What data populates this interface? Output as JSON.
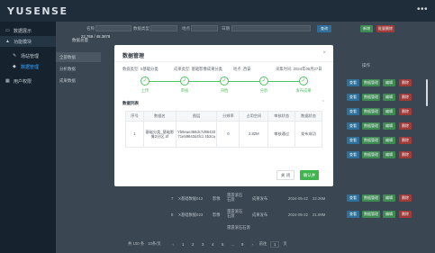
{
  "app": {
    "logo": "YUSENSE",
    "more_label": "•••"
  },
  "sidebar": {
    "items": [
      {
        "label": "数据展示",
        "icon": "monitor-icon"
      },
      {
        "label": "功能模块",
        "icon": "user-icon"
      },
      {
        "label": "场站管理",
        "icon": "gear-icon"
      },
      {
        "label": "数据管理",
        "icon": "cube-icon"
      },
      {
        "label": "用户权限",
        "icon": "grid-icon"
      }
    ]
  },
  "filters": {
    "labels": [
      "名称",
      "数据类型",
      "地点",
      "日期"
    ],
    "values": [
      "请输入名称",
      "请选择类型",
      "请选择",
      "开始日期",
      "结束日期"
    ],
    "search_button": "查询",
    "add_button": "新增",
    "delete_button": "批量删除"
  },
  "stat": {
    "label": "数据总量",
    "value": "22.769 / 48.3878"
  },
  "tabs": [
    "全部数据",
    "分析数据",
    "成果数据"
  ],
  "table": {
    "op_header": "操作",
    "action_labels": [
      "查看",
      "数据管理",
      "编辑",
      "删除"
    ],
    "rows": [
      {
        "index": "7",
        "name": "X基础数据012",
        "type": "影像",
        "place": "雷霆滚石石渡",
        "status": "成果发布",
        "date": "2024-05-22",
        "size": "22.36M"
      },
      {
        "index": "8",
        "name": "X基础数据023",
        "type": "影像",
        "place": "雷霆滚石石渡",
        "status": "成果发布",
        "date": "2024-05-22",
        "size": "21.99M"
      },
      {
        "index": "9",
        "name": "",
        "type": "",
        "place": "雷霆滚石石渡",
        "status": "",
        "date": "",
        "size": ""
      }
    ]
  },
  "pager": {
    "total": "共 100 条",
    "page_size": "10条/页",
    "pages": [
      "1",
      "2",
      "3",
      "4",
      "5",
      "...",
      "9"
    ],
    "goto_label": "前往",
    "goto_value": "1",
    "goto_unit": "页"
  },
  "modal": {
    "title": "数据管理",
    "close": "×",
    "info": {
      "type_label": "数据类型:",
      "type_value": "X基础分类",
      "product_label": "成果类型:",
      "product_value": "基础影像成果分类",
      "place_label": "地点:",
      "place_value": "西安",
      "date_label": "采集时间:",
      "date_value": "2024年05月27日"
    },
    "steps": [
      "上传",
      "审核",
      "归档",
      "分析",
      "发布成果"
    ],
    "section_title": "数据列表",
    "file_table": {
      "headers": [
        "序号",
        "数据名",
        "图层",
        "分辨率",
        "占用空间",
        "审核状态",
        "数据状态"
      ],
      "rows": [
        {
          "index": "1",
          "name": "基础分类_基础影像2分区.tif",
          "layer": "Yb8eae366dc7d8643371e59843d4fc1 4b2ca",
          "resolution": "0",
          "size": "2.82M",
          "review": "审核通过",
          "status": "发布成功"
        }
      ]
    },
    "cancel": "关 闭",
    "confirm": "确认并"
  }
}
